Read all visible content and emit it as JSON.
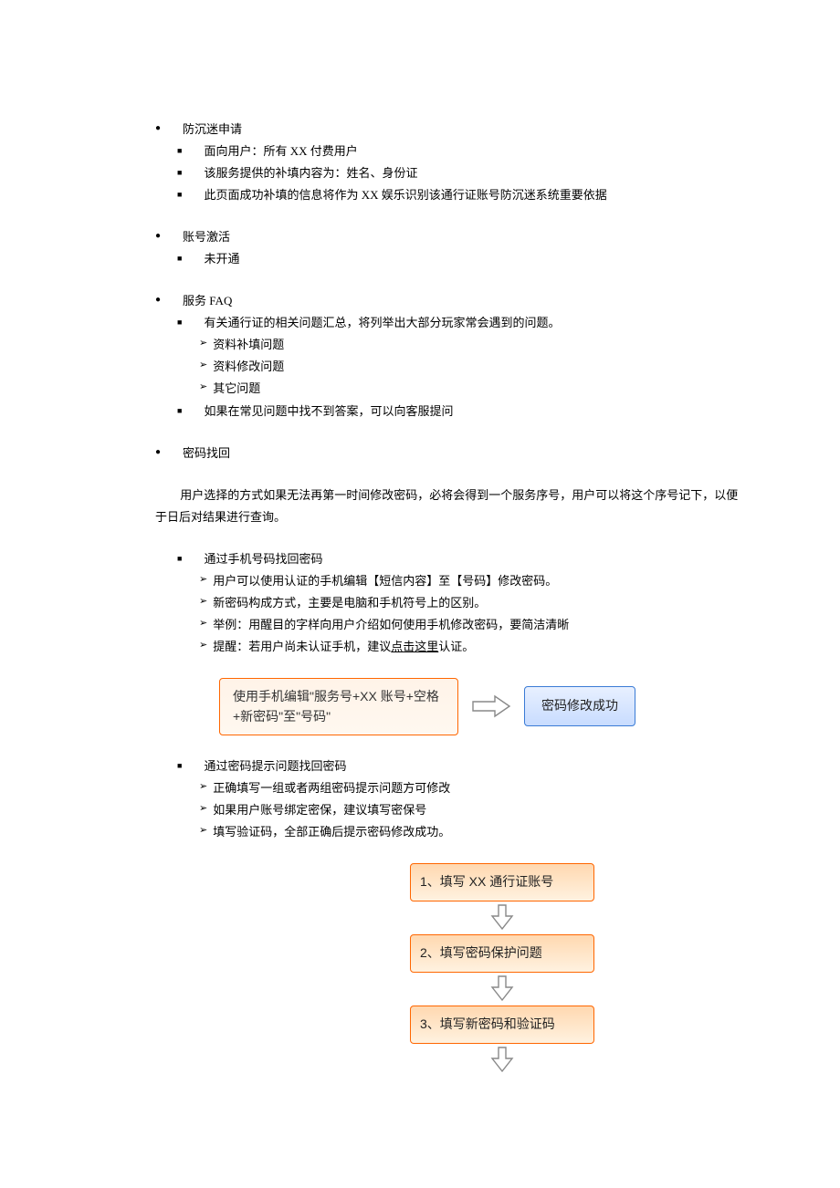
{
  "sections": {
    "s1": {
      "title": "防沉迷申请",
      "items": [
        "面向用户：所有 XX 付费用户",
        "该服务提供的补填内容为：姓名、身份证",
        "此页面成功补填的信息将作为 XX 娱乐识别该通行证账号防沉迷系统重要依据"
      ]
    },
    "s2": {
      "title": "账号激活",
      "items": [
        "未开通"
      ]
    },
    "s3": {
      "title": "服务 FAQ",
      "items": [
        "有关通行证的相关问题汇总，将列举出大部分玩家常会遇到的问题。",
        "如果在常见问题中找不到答案，可以向客服提问"
      ],
      "sub": [
        "资料补填问题",
        "资料修改问题",
        "其它问题"
      ]
    },
    "s4": {
      "title": "密码找回",
      "para": "用户选择的方式如果无法再第一时间修改密码，必将会得到一个服务序号，用户可以将这个序号记下，以便于日后对结果进行查询。",
      "m1": {
        "title": "通过手机号码找回密码",
        "items": [
          "用户可以使用认证的手机编辑【短信内容】至【号码】修改密码。",
          "新密码构成方式，主要是电脑和手机符号上的区别。",
          "举例：用醒目的字样向用户介绍如何使用手机修改密码，要简洁清晰"
        ],
        "tip_prefix": "提醒：若用户尚未认证手机，建议",
        "tip_link": "点击这里",
        "tip_suffix": "认证。"
      },
      "flow_h": {
        "left": "使用手机编辑\"服务号+XX 账号+空格+新密码\"至\"号码\"",
        "right": "密码修改成功"
      },
      "m2": {
        "title": "通过密码提示问题找回密码",
        "items": [
          "正确填写一组或者两组密码提示问题方可修改",
          "如果用户账号绑定密保，建议填写密保号",
          "填写验证码，全部正确后提示密码修改成功。"
        ]
      },
      "flow_v": [
        "1、填写 XX 通行证账号",
        "2、填写密码保护问题",
        "3、填写新密码和验证码"
      ]
    }
  }
}
